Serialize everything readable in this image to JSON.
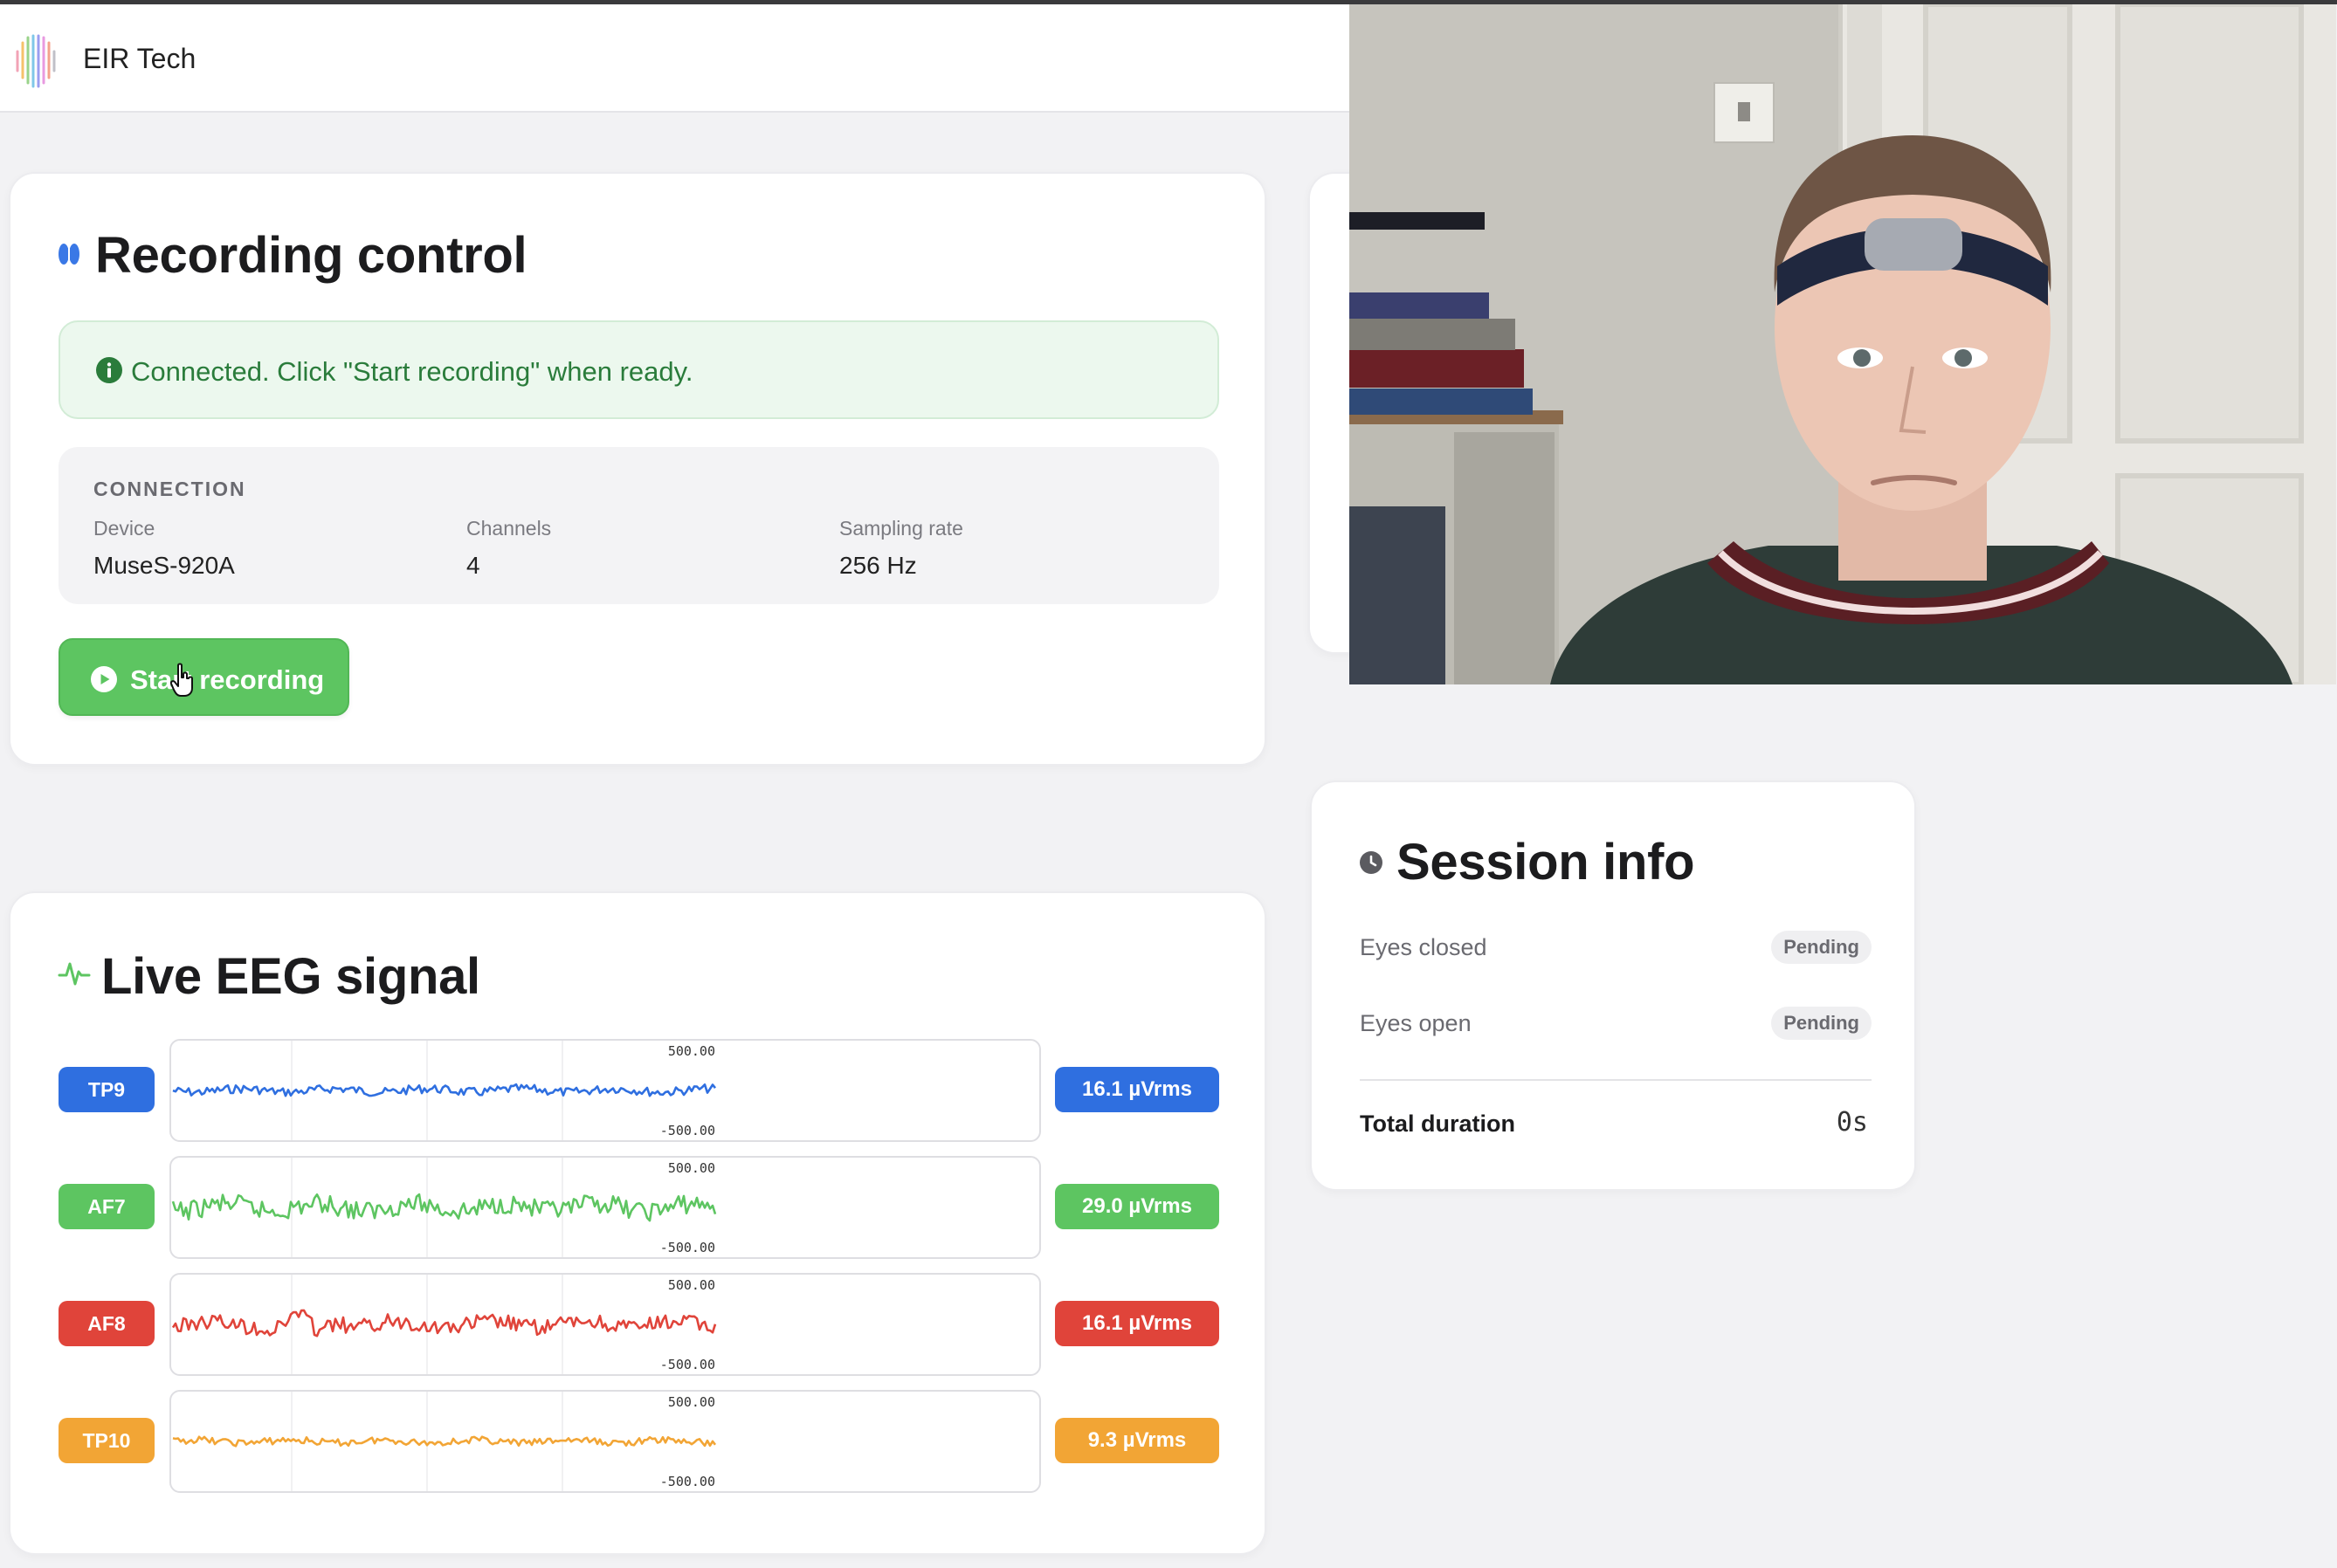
{
  "app": {
    "brand_name": "EIR Tech"
  },
  "recording_control": {
    "title": "Recording control",
    "status_message": "Connected. Click \"Start recording\" when ready.",
    "connection": {
      "heading": "CONNECTION",
      "device_label": "Device",
      "device_value": "MuseS-920A",
      "channels_label": "Channels",
      "channels_value": "4",
      "sampling_label": "Sampling rate",
      "sampling_value": "256 Hz"
    },
    "start_button_label": "Start recording"
  },
  "live_eeg": {
    "title": "Live EEG signal",
    "channels": [
      {
        "name": "TP9",
        "rms": "16.1 µVrms",
        "color": "#2f6fe0",
        "y_max_label": "500.00",
        "y_min_label": "-500.00"
      },
      {
        "name": "AF7",
        "rms": "29.0 µVrms",
        "color": "#5dc561",
        "y_max_label": "500.00",
        "y_min_label": "-500.00"
      },
      {
        "name": "AF8",
        "rms": "16.1 µVrms",
        "color": "#e0443a",
        "y_max_label": "500.00",
        "y_min_label": "-500.00"
      },
      {
        "name": "TP10",
        "rms": "9.3 µVrms",
        "color": "#f2a535",
        "y_max_label": "500.00",
        "y_min_label": "-500.00"
      }
    ]
  },
  "session_info": {
    "title": "Session info",
    "rows": [
      {
        "label": "Eyes closed",
        "status": "Pending"
      },
      {
        "label": "Eyes open",
        "status": "Pending"
      }
    ],
    "total_label": "Total duration",
    "total_value": "0s"
  },
  "colors": {
    "accent_green": "#5dc561",
    "accent_blue": "#2f6fe0",
    "accent_red": "#e0443a",
    "accent_orange": "#f2a535",
    "success_text": "#2a7c3b"
  }
}
